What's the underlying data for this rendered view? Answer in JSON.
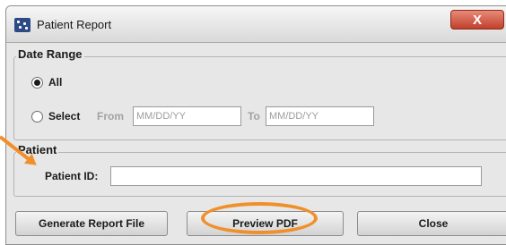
{
  "window": {
    "title": "Patient Report",
    "close_glyph": "X"
  },
  "date_range": {
    "legend": "Date Range",
    "all_label": "All",
    "select_label": "Select",
    "from_label": "From",
    "to_label": "To",
    "from_placeholder": "MM/DD/YY",
    "to_placeholder": "MM/DD/YY",
    "selected": "All"
  },
  "patient": {
    "legend": "Patient",
    "id_label": "Patient ID:",
    "id_value": ""
  },
  "buttons": {
    "generate": "Generate Report File",
    "preview": "Preview PDF",
    "close": "Close"
  },
  "colors": {
    "highlight": "#f0902a",
    "close_button": "#c0402c"
  }
}
